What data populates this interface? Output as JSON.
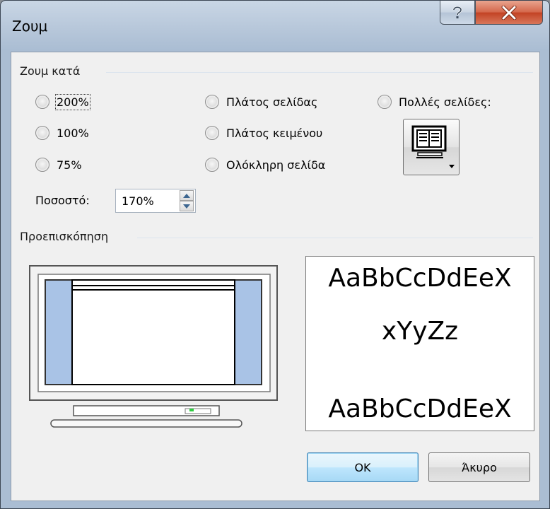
{
  "window": {
    "title": "Ζουμ"
  },
  "zoom_group": {
    "title": "Ζουμ κατά",
    "options": [
      {
        "label": "200%",
        "selected": false
      },
      {
        "label": "100%",
        "selected": false
      },
      {
        "label": "75%",
        "selected": false
      },
      {
        "label": "Πλάτος σελίδας",
        "selected": false
      },
      {
        "label": "Πλάτος κειμένου",
        "selected": false
      },
      {
        "label": "Ολόκληρη σελίδα",
        "selected": false
      },
      {
        "label": "Πολλές σελίδες:",
        "selected": false
      }
    ],
    "percent_label": "Ποσοστό:",
    "percent_value": "170%"
  },
  "preview_group": {
    "title": "Προεπισκόπηση",
    "sample_lines": [
      "AaBbCcDdEeX",
      "xYyZz",
      "AaBbCcDdEeX"
    ]
  },
  "buttons": {
    "ok": "OK",
    "cancel": "Άκυρο"
  },
  "icons": {
    "help": "help-icon",
    "close": "close-icon",
    "multiple_pages": "multiple-pages-monitor-icon",
    "spin_up": "spin-up-arrow-icon",
    "spin_down": "spin-down-arrow-icon"
  },
  "colors": {
    "preview_margin": "#a9c3e6",
    "close_button": "#c9492b",
    "default_button_border": "#3c7fb1"
  }
}
